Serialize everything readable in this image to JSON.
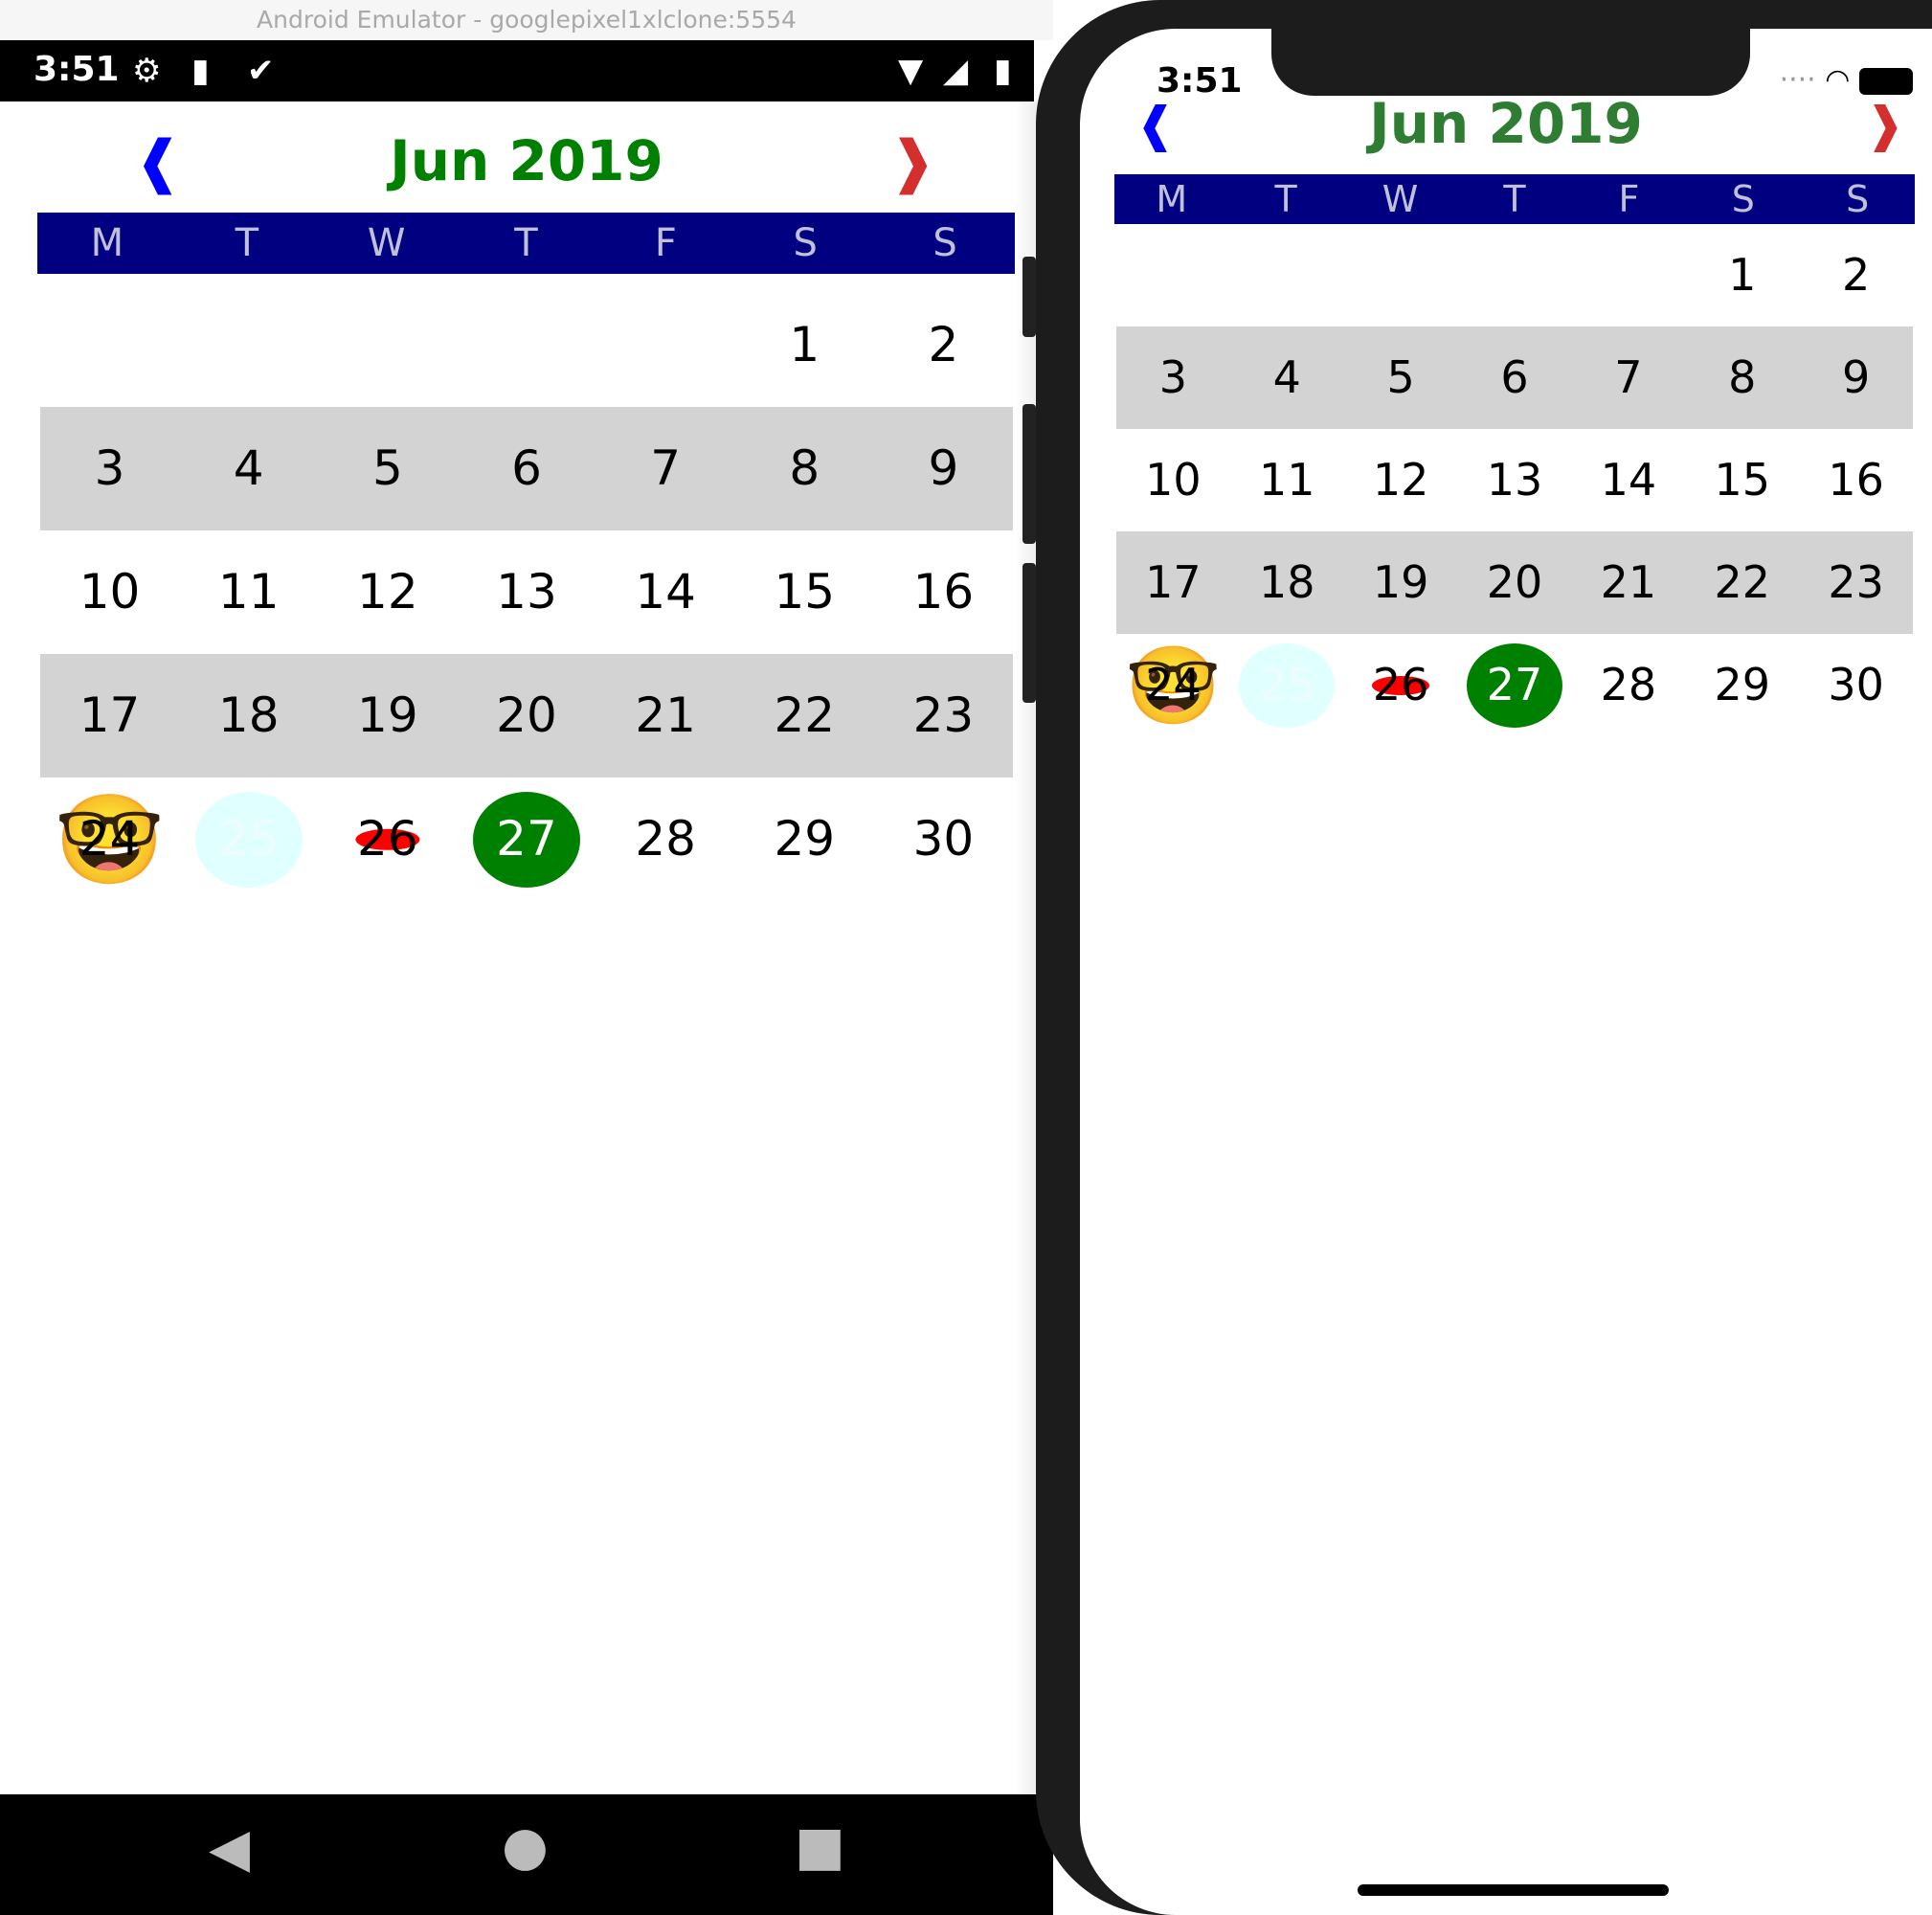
{
  "android": {
    "window_title": "Android Emulator - googlepixel1xlclone:5554",
    "status_time": "3:51",
    "nav": {
      "back": "◀",
      "home": "●",
      "recents": "■"
    }
  },
  "ios": {
    "status_time": "3:51"
  },
  "calendar": {
    "title": "Jun 2019",
    "prev_label": "❰",
    "next_label": "❱",
    "weekdays": [
      "M",
      "T",
      "W",
      "T",
      "F",
      "S",
      "S"
    ],
    "weeks": [
      [
        "",
        "",
        "",
        "",
        "",
        "1",
        "2"
      ],
      [
        "3",
        "4",
        "5",
        "6",
        "7",
        "8",
        "9"
      ],
      [
        "10",
        "11",
        "12",
        "13",
        "14",
        "15",
        "16"
      ],
      [
        "17",
        "18",
        "19",
        "20",
        "21",
        "22",
        "23"
      ],
      [
        "24",
        "25",
        "26",
        "27",
        "28",
        "29",
        "30"
      ]
    ],
    "shaded_weeks": [
      1,
      3
    ],
    "special_days": {
      "24": "nerd-face-emoji",
      "25": "light-cyan-circle",
      "26": "red-dot",
      "27": "selected-green-circle"
    },
    "colors": {
      "title": "#008000",
      "prev_arrow": "#0000ff",
      "next_arrow": "#d32f2f",
      "weekday_bar": "#000080",
      "shaded_row": "#d3d3d3",
      "selected": "#008000",
      "cyan": "#e0ffff",
      "red_dot": "#ff0000"
    }
  }
}
